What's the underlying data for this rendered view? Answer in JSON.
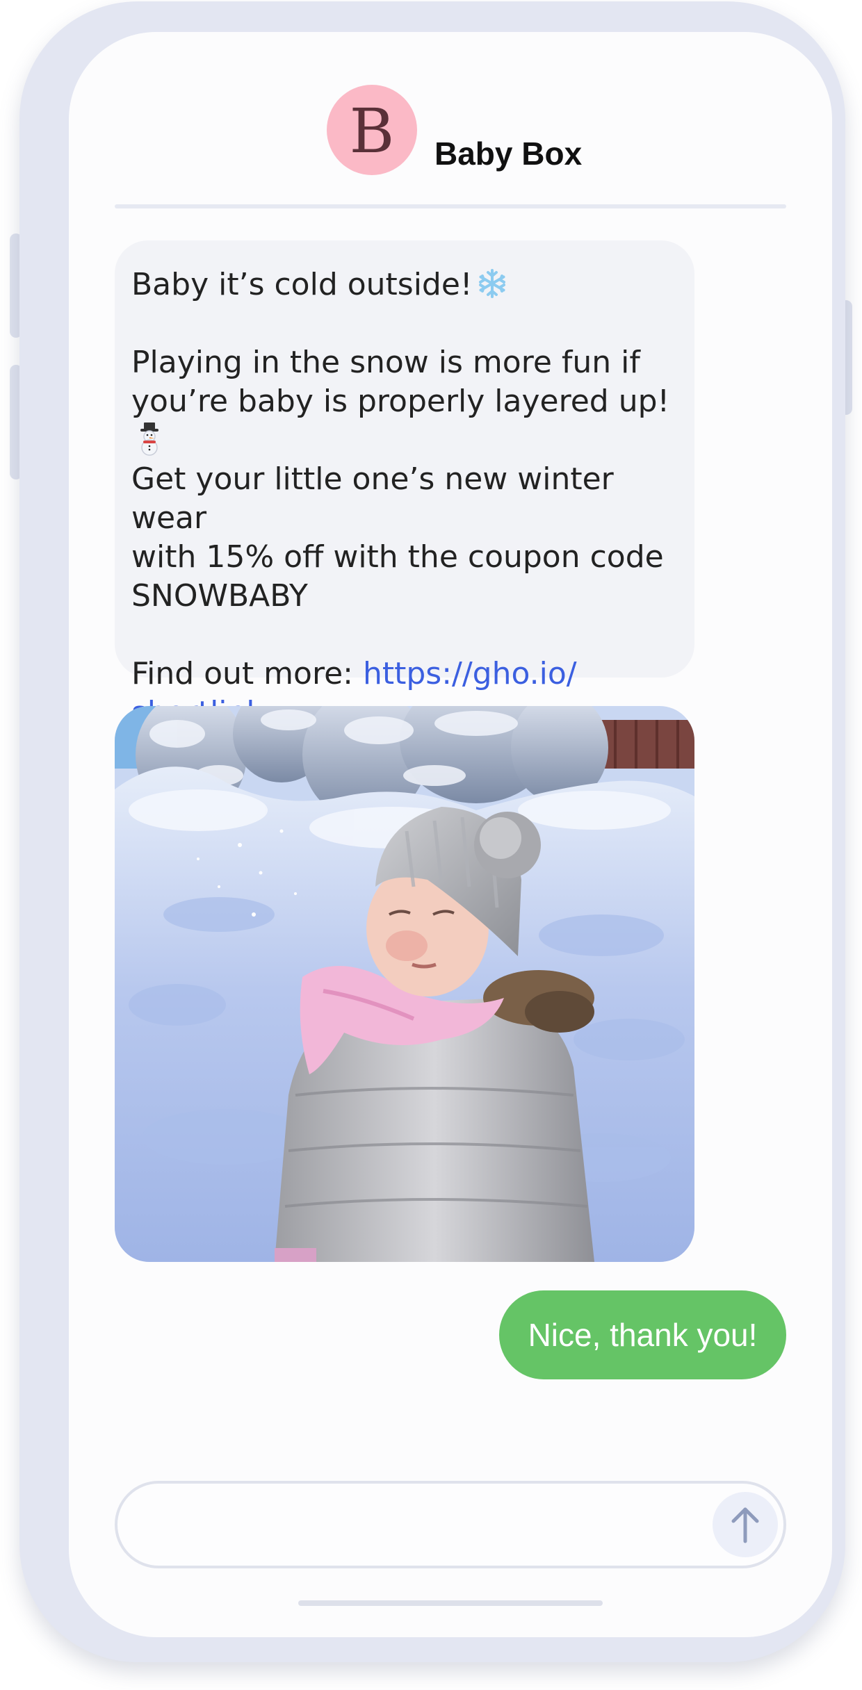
{
  "contact": {
    "name": "Baby Box",
    "avatar_letter": "B"
  },
  "messages": {
    "incoming": {
      "line1": "Baby it’s cold outside!",
      "line2": "Playing in the snow is more fun if",
      "line3": "you’re baby is properly layered up!",
      "line4": "Get your little one’s new winter wear",
      "line5": "with 15% off with the coupon code",
      "line6": "SNOWBABY",
      "link_prefix": "Find out more: ",
      "link_part1": "https://gho.io/",
      "link_part2": "shortlink"
    },
    "outgoing": "Nice, thank you!"
  },
  "composer": {
    "placeholder": ""
  },
  "icons": {
    "snowflake": "snowflake-emoji",
    "snowman": "snowman-emoji",
    "send": "arrow-up-icon"
  },
  "colors": {
    "avatar_bg": "#fbb9c6",
    "incoming_bg": "#f2f3f7",
    "outgoing_bg": "#65c466",
    "link": "#3b5fe0",
    "frame": "#e3e6f2"
  }
}
